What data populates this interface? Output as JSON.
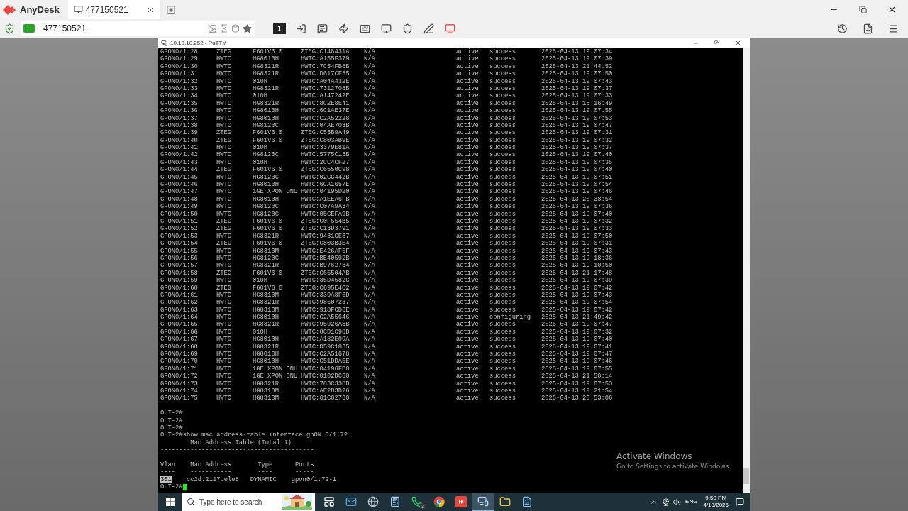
{
  "anydesk": {
    "brand": "AnyDesk",
    "tab": {
      "title": "477150521",
      "selected": true
    },
    "address": "477150521",
    "display_button": "1"
  },
  "putty": {
    "title": "10.10.10.252 - PuTTY",
    "rows": [
      [
        "GPON0/1:28",
        "ZTEG",
        "F601V6.0",
        "ZTEG:C148431A",
        "N/A",
        "active",
        "success",
        "2025-04-13 19:07:34"
      ],
      [
        "GPON0/1:29",
        "HWTC",
        "HG8010H",
        "HWTC:A155F379",
        "N/A",
        "active",
        "success",
        "2025-04-13 19:07:39"
      ],
      [
        "GPON0/1:30",
        "HWTC",
        "HG8321R",
        "HWTC:7C54FB8B",
        "N/A",
        "active",
        "success",
        "2025-04-13 21:44:52"
      ],
      [
        "GPON0/1:31",
        "HWTC",
        "HG8321R",
        "HWTC:D617CF35",
        "N/A",
        "active",
        "success",
        "2025-04-13 19:07:50"
      ],
      [
        "GPON0/1:32",
        "HWTC",
        "010H",
        "HWTC:A04A432E",
        "N/A",
        "active",
        "success",
        "2025-04-13 19:07:43"
      ],
      [
        "GPON0/1:33",
        "HWTC",
        "HG8321R",
        "HWTC:7312708B",
        "N/A",
        "active",
        "success",
        "2025-04-13 19:07:37"
      ],
      [
        "GPON0/1:34",
        "HWTC",
        "010H",
        "HWTC:A147242E",
        "N/A",
        "active",
        "success",
        "2025-04-13 19:07:33"
      ],
      [
        "GPON0/1:35",
        "HWTC",
        "HG8321R",
        "HWTC:8C2E8E41",
        "N/A",
        "active",
        "success",
        "2025-04-13 18:16:49"
      ],
      [
        "GPON0/1:36",
        "HWTC",
        "HG8010H",
        "HWTC:6C1AE37E",
        "N/A",
        "active",
        "success",
        "2025-04-13 19:07:55"
      ],
      [
        "GPON0/1:37",
        "HWTC",
        "HG8010H",
        "HWTC:C2A52228",
        "N/A",
        "active",
        "success",
        "2025-04-13 19:07:53"
      ],
      [
        "GPON0/1:38",
        "HWTC",
        "HG8120C",
        "HWTC:04AE703B",
        "N/A",
        "active",
        "success",
        "2025-04-13 19:07:47"
      ],
      [
        "GPON0/1:39",
        "ZTEG",
        "F601V6.0",
        "ZTEG:C53B9A49",
        "N/A",
        "active",
        "success",
        "2025-04-13 19:07:31"
      ],
      [
        "GPON0/1:40",
        "ZTEG",
        "F601V6.0",
        "ZTEG:C803AB9E",
        "N/A",
        "active",
        "success",
        "2025-04-13 19:07:32"
      ],
      [
        "GPON0/1:41",
        "HWTC",
        "010H",
        "HWTC:3379E81A",
        "N/A",
        "active",
        "success",
        "2025-04-13 19:07:37"
      ],
      [
        "GPON0/1:42",
        "HWTC",
        "HG8120C",
        "HWTC:5775C13B",
        "N/A",
        "active",
        "success",
        "2025-04-13 19:07:40"
      ],
      [
        "GPON0/1:43",
        "HWTC",
        "010H",
        "HWTC:2CC4CF27",
        "N/A",
        "active",
        "success",
        "2025-04-13 19:07:35"
      ],
      [
        "GPON0/1:44",
        "ZTEG",
        "F601V6.0",
        "ZTEG:C6550C98",
        "N/A",
        "active",
        "success",
        "2025-04-13 19:07:40"
      ],
      [
        "GPON0/1:45",
        "HWTC",
        "HG8120C",
        "HWTC:02CC442B",
        "N/A",
        "active",
        "success",
        "2025-04-13 19:07:51"
      ],
      [
        "GPON0/1:46",
        "HWTC",
        "HG8010H",
        "HWTC:6CA1657E",
        "N/A",
        "active",
        "success",
        "2025-04-13 19:07:54"
      ],
      [
        "GPON0/1:47",
        "HWTC",
        "1GE XPON ONU",
        "HWTC:04195D20",
        "N/A",
        "active",
        "success",
        "2025-04-13 19:07:46"
      ],
      [
        "GPON0/1:48",
        "HWTC",
        "HG8010H",
        "HWTC:A1EEA6FB",
        "N/A",
        "active",
        "success",
        "2025-04-13 20:38:54"
      ],
      [
        "GPON0/1:49",
        "HWTC",
        "HG8120C",
        "HWTC:C07A9A34",
        "N/A",
        "active",
        "success",
        "2025-04-13 19:07:36"
      ],
      [
        "GPON0/1:50",
        "HWTC",
        "HG8120C",
        "HWTC:05CEFA9B",
        "N/A",
        "active",
        "success",
        "2025-04-13 19:07:40"
      ],
      [
        "GPON0/1:51",
        "ZTEG",
        "F601V6.0",
        "ZTEG:C0F554B5",
        "N/A",
        "active",
        "success",
        "2025-04-13 19:07:32"
      ],
      [
        "GPON0/1:52",
        "ZTEG",
        "F601V6.0",
        "ZTEG:C13D3791",
        "N/A",
        "active",
        "success",
        "2025-04-13 19:07:33"
      ],
      [
        "GPON0/1:53",
        "HWTC",
        "HG8321R",
        "HWTC:9431CE37",
        "N/A",
        "active",
        "success",
        "2025-04-13 19:07:50"
      ],
      [
        "GPON0/1:54",
        "ZTEG",
        "F601V6.0",
        "ZTEG:C803B3E4",
        "N/A",
        "active",
        "success",
        "2025-04-13 19:07:31"
      ],
      [
        "GPON0/1:55",
        "HWTC",
        "HG8310M",
        "HWTC:E426AF5F",
        "N/A",
        "active",
        "success",
        "2025-04-13 19:07:43"
      ],
      [
        "GPON0/1:56",
        "HWTC",
        "HG8120C",
        "HWTC:BE40592B",
        "N/A",
        "active",
        "success",
        "2025-04-13 19:18:36"
      ],
      [
        "GPON0/1:57",
        "HWTC",
        "HG8321R",
        "HWTC:B9762734",
        "N/A",
        "active",
        "success",
        "2025-04-13 19:10:50"
      ],
      [
        "GPON0/1:58",
        "ZTEG",
        "F601V6.0",
        "ZTEG:C65504AB",
        "N/A",
        "active",
        "success",
        "2025-04-13 21:17:48"
      ],
      [
        "GPON0/1:59",
        "HWTC",
        "010H",
        "HWTC:85D4582C",
        "N/A",
        "active",
        "success",
        "2025-04-13 19:07:39"
      ],
      [
        "GPON0/1:60",
        "ZTEG",
        "F601V6.0",
        "ZTEG:C695E4C2",
        "N/A",
        "active",
        "success",
        "2025-04-13 19:07:42"
      ],
      [
        "GPON0/1:61",
        "HWTC",
        "HG8310M",
        "HWTC:339A8F6D",
        "N/A",
        "active",
        "success",
        "2025-04-13 19:07:43"
      ],
      [
        "GPON0/1:62",
        "HWTC",
        "HG8321R",
        "HWTC:98607237",
        "N/A",
        "active",
        "success",
        "2025-04-13 19:07:54"
      ],
      [
        "GPON0/1:63",
        "HWTC",
        "HG8310M",
        "HWTC:918FCD6E",
        "N/A",
        "active",
        "success",
        "2025-04-13 19:07:42"
      ],
      [
        "GPON0/1:64",
        "HWTC",
        "HG8010H",
        "HWTC:C2A55646",
        "N/A",
        "active",
        "configuring",
        "2025-04-13 21:49:42"
      ],
      [
        "GPON0/1:65",
        "HWTC",
        "HG8321R",
        "HWTC:95926A8B",
        "N/A",
        "active",
        "success",
        "2025-04-13 19:07:47"
      ],
      [
        "GPON0/1:66",
        "HWTC",
        "010H",
        "HWTC:8CD1C98D",
        "N/A",
        "active",
        "success",
        "2025-04-13 19:07:32"
      ],
      [
        "GPON0/1:67",
        "HWTC",
        "HG8010H",
        "HWTC:A182E09A",
        "N/A",
        "active",
        "success",
        "2025-04-13 19:07:40"
      ],
      [
        "GPON0/1:68",
        "HWTC",
        "HG8321R",
        "HWTC:D59C1835",
        "N/A",
        "active",
        "success",
        "2025-04-13 19:07:41"
      ],
      [
        "GPON0/1:69",
        "HWTC",
        "HG8010H",
        "HWTC:C2A51678",
        "N/A",
        "active",
        "success",
        "2025-04-13 19:07:47"
      ],
      [
        "GPON0/1:70",
        "HWTC",
        "HG8010H",
        "HWTC:C51DDA5E",
        "N/A",
        "active",
        "success",
        "2025-04-13 19:07:46"
      ],
      [
        "GPON0/1:71",
        "HWTC",
        "1GE XPON ONU",
        "HWTC:04196FB0",
        "N/A",
        "active",
        "success",
        "2025-04-13 19:07:55"
      ],
      [
        "GPON0/1:72",
        "HWTC",
        "1GE XPON ONU",
        "HWTC:0102DC60",
        "N/A",
        "active",
        "success",
        "2025-04-13 21:50:14"
      ],
      [
        "GPON0/1:73",
        "HWTC",
        "HG8321R",
        "HWTC:783C338B",
        "N/A",
        "active",
        "success",
        "2025-04-13 19:07:53"
      ],
      [
        "GPON0/1:74",
        "HWTC",
        "HG8310M",
        "HWTC:AE2B3D26",
        "N/A",
        "active",
        "success",
        "2025-04-13 19:21:54"
      ],
      [
        "GPON0/1:75",
        "HWTC",
        "HG8310M",
        "HWTC:61C62760",
        "N/A",
        "active",
        "success",
        "2025-04-13 20:53:06"
      ]
    ],
    "prompts": [
      "OLT-2#",
      "OLT-2#",
      "OLT-2#"
    ],
    "command": "OLT-2#show mac address-table interface gpON 0/1:72",
    "table_title": "        Mac Address Table (Total 1)",
    "rule": "-----------------------------------------",
    "header": "Vlan    Mac Address       Type      Ports",
    "header_rule": "----    -----------       ----      -----",
    "mac_row": {
      "vlan": {
        "text": "301",
        "selected": true
      },
      "rest": "    cc2d.2117.ele8   DYNAMIC    gpon0/1:72-1"
    },
    "last_prompt": "OLT-2#",
    "cursor": true
  },
  "watermark": {
    "title": "Activate Windows",
    "subtitle": "Go to Settings to activate Windows."
  },
  "taskbar": {
    "search_placeholder": "Type here to search",
    "apps": [
      {
        "selected": false
      },
      {
        "selected": false
      },
      {
        "selected": false
      },
      {
        "selected": false
      },
      {
        "selected": false,
        "badge": "3"
      },
      {
        "selected": false
      },
      {
        "selected": false
      },
      {
        "selected": true
      },
      {
        "selected": false
      },
      {
        "selected": false
      }
    ],
    "language": "ENG",
    "time": "9:50 PM",
    "date": "4/13/2025"
  }
}
